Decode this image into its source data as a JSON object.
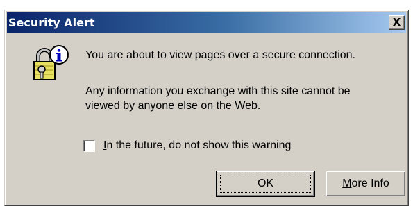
{
  "window": {
    "title": "Security Alert",
    "close_label": "X"
  },
  "icon": {
    "name": "lock-info-icon"
  },
  "message": {
    "line1": "You are about to view pages over a secure connection.",
    "line2": "Any information you exchange with this site cannot be viewed by anyone else on the Web."
  },
  "checkbox": {
    "label_mnemonic": "I",
    "label_rest": "n the future, do not show this warning",
    "checked": false
  },
  "buttons": {
    "ok_label": "OK",
    "more_mnemonic": "M",
    "more_rest": "ore Info"
  },
  "colors": {
    "titlebar_start": "#0a246a",
    "titlebar_end": "#a6caf0",
    "face": "#d4d0c8"
  }
}
